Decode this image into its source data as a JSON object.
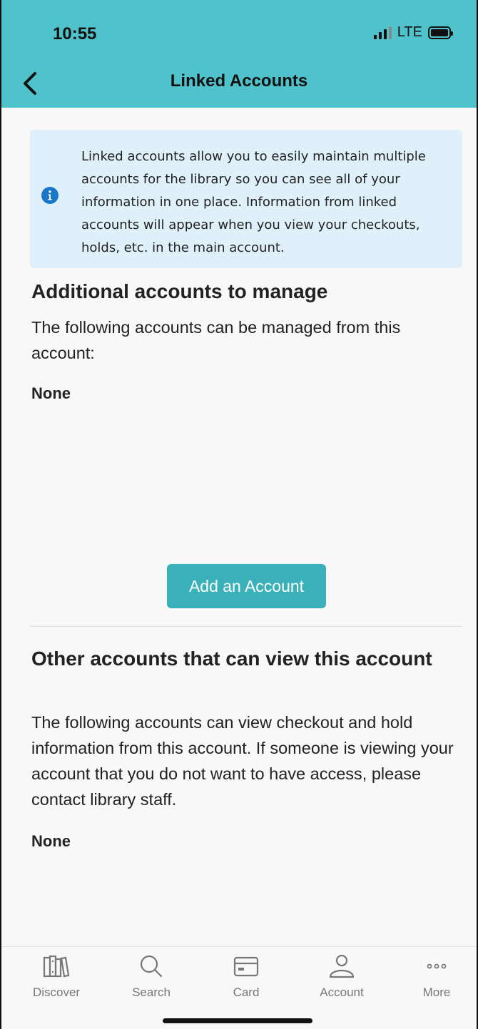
{
  "status_bar": {
    "time": "10:55",
    "network": "LTE"
  },
  "header": {
    "title": "Linked Accounts"
  },
  "info": {
    "text": "Linked accounts allow you to easily maintain multiple accounts for the library so you can see all of your information in one place. Information from linked accounts will appear when you view your checkouts, holds, etc. in the main account."
  },
  "manage_section": {
    "title": "Additional accounts to manage",
    "description": "The following accounts can be managed from this account:",
    "empty": "None",
    "add_button": "Add an Account"
  },
  "viewers_section": {
    "title": "Other accounts that can view this account",
    "description": "The following accounts can view checkout and hold information from this account. If someone is viewing your account that you do not want to have access, please contact library staff.",
    "empty": "None"
  },
  "tabs": [
    {
      "label": "Discover",
      "icon": "books-icon"
    },
    {
      "label": "Search",
      "icon": "search-icon"
    },
    {
      "label": "Card",
      "icon": "card-icon"
    },
    {
      "label": "Account",
      "icon": "user-icon"
    },
    {
      "label": "More",
      "icon": "more-icon"
    }
  ],
  "colors": {
    "header": "#50c2cc",
    "info_bg": "#dff0fa",
    "button": "#3ab1b8",
    "info_icon": "#1976c9"
  }
}
